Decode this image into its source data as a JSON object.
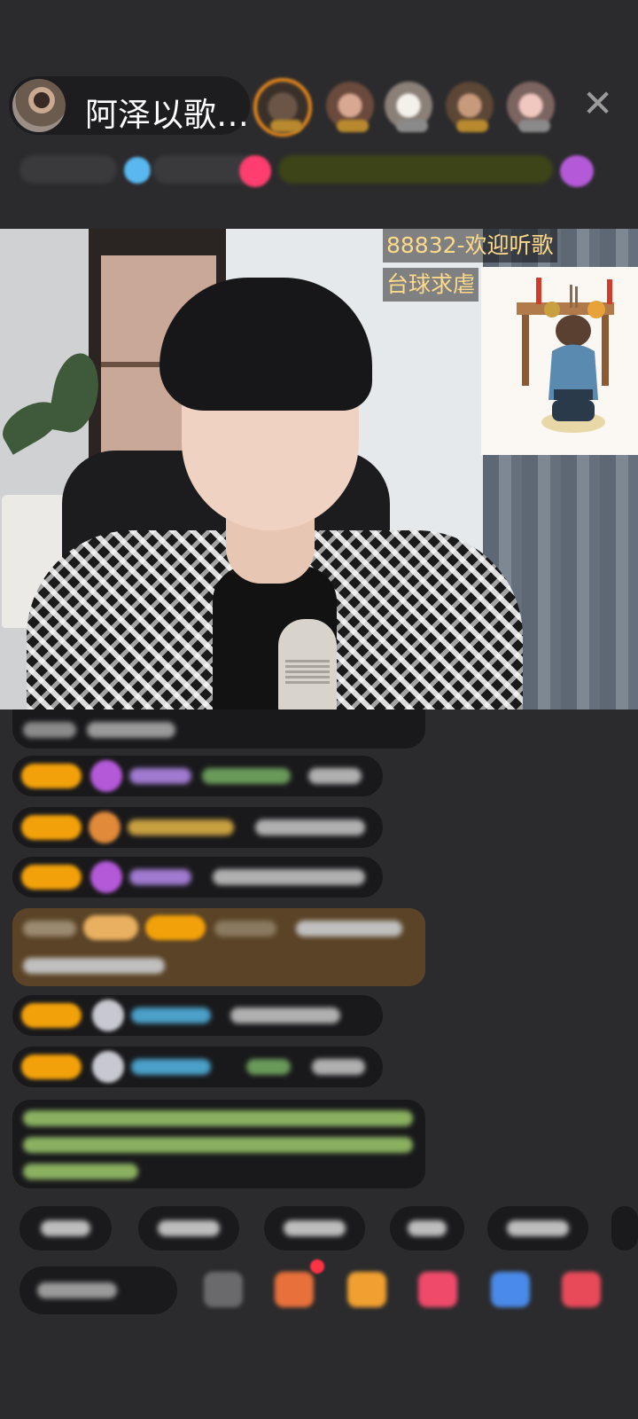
{
  "host": {
    "name": "阿泽以歌…",
    "avatar_icon": "host-avatar"
  },
  "header": {
    "close_icon": "close-icon",
    "close_glyph": "✕"
  },
  "video": {
    "overlay_line1": "88832-欢迎听歌",
    "overlay_line2": "台球求虐",
    "sticker_icon": "praying-figure-sticker"
  },
  "colors": {
    "background": "#2b2b2d",
    "level_badge": "#f2a10a",
    "overlay_text": "#ffd98a",
    "gift_row": "#5a4326"
  }
}
